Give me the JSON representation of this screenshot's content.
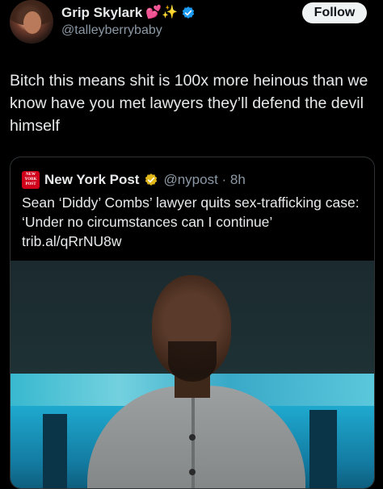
{
  "author": {
    "display_name": "Grip Skylark",
    "emoji": "💕✨",
    "handle": "@talleyberrybaby"
  },
  "follow_label": "Follow",
  "tweet_text": "Bitch this means shit is 100x more heinous than we know have you met lawyers they’ll defend the devil himself",
  "quote": {
    "logo_text": [
      "NEW",
      "YORK",
      "POST"
    ],
    "name": "New York Post",
    "handle_time": "@nypost · 8h",
    "text": "Sean ‘Diddy’ Combs’ lawyer quits sex-trafficking case: ‘Under no circumstances can I continue’",
    "link": "trib.al/qRrNU8w"
  },
  "colors": {
    "verified_blue": "#1d9bf0",
    "gold_check": "#e2b719",
    "nyp_red": "#d0021b"
  }
}
